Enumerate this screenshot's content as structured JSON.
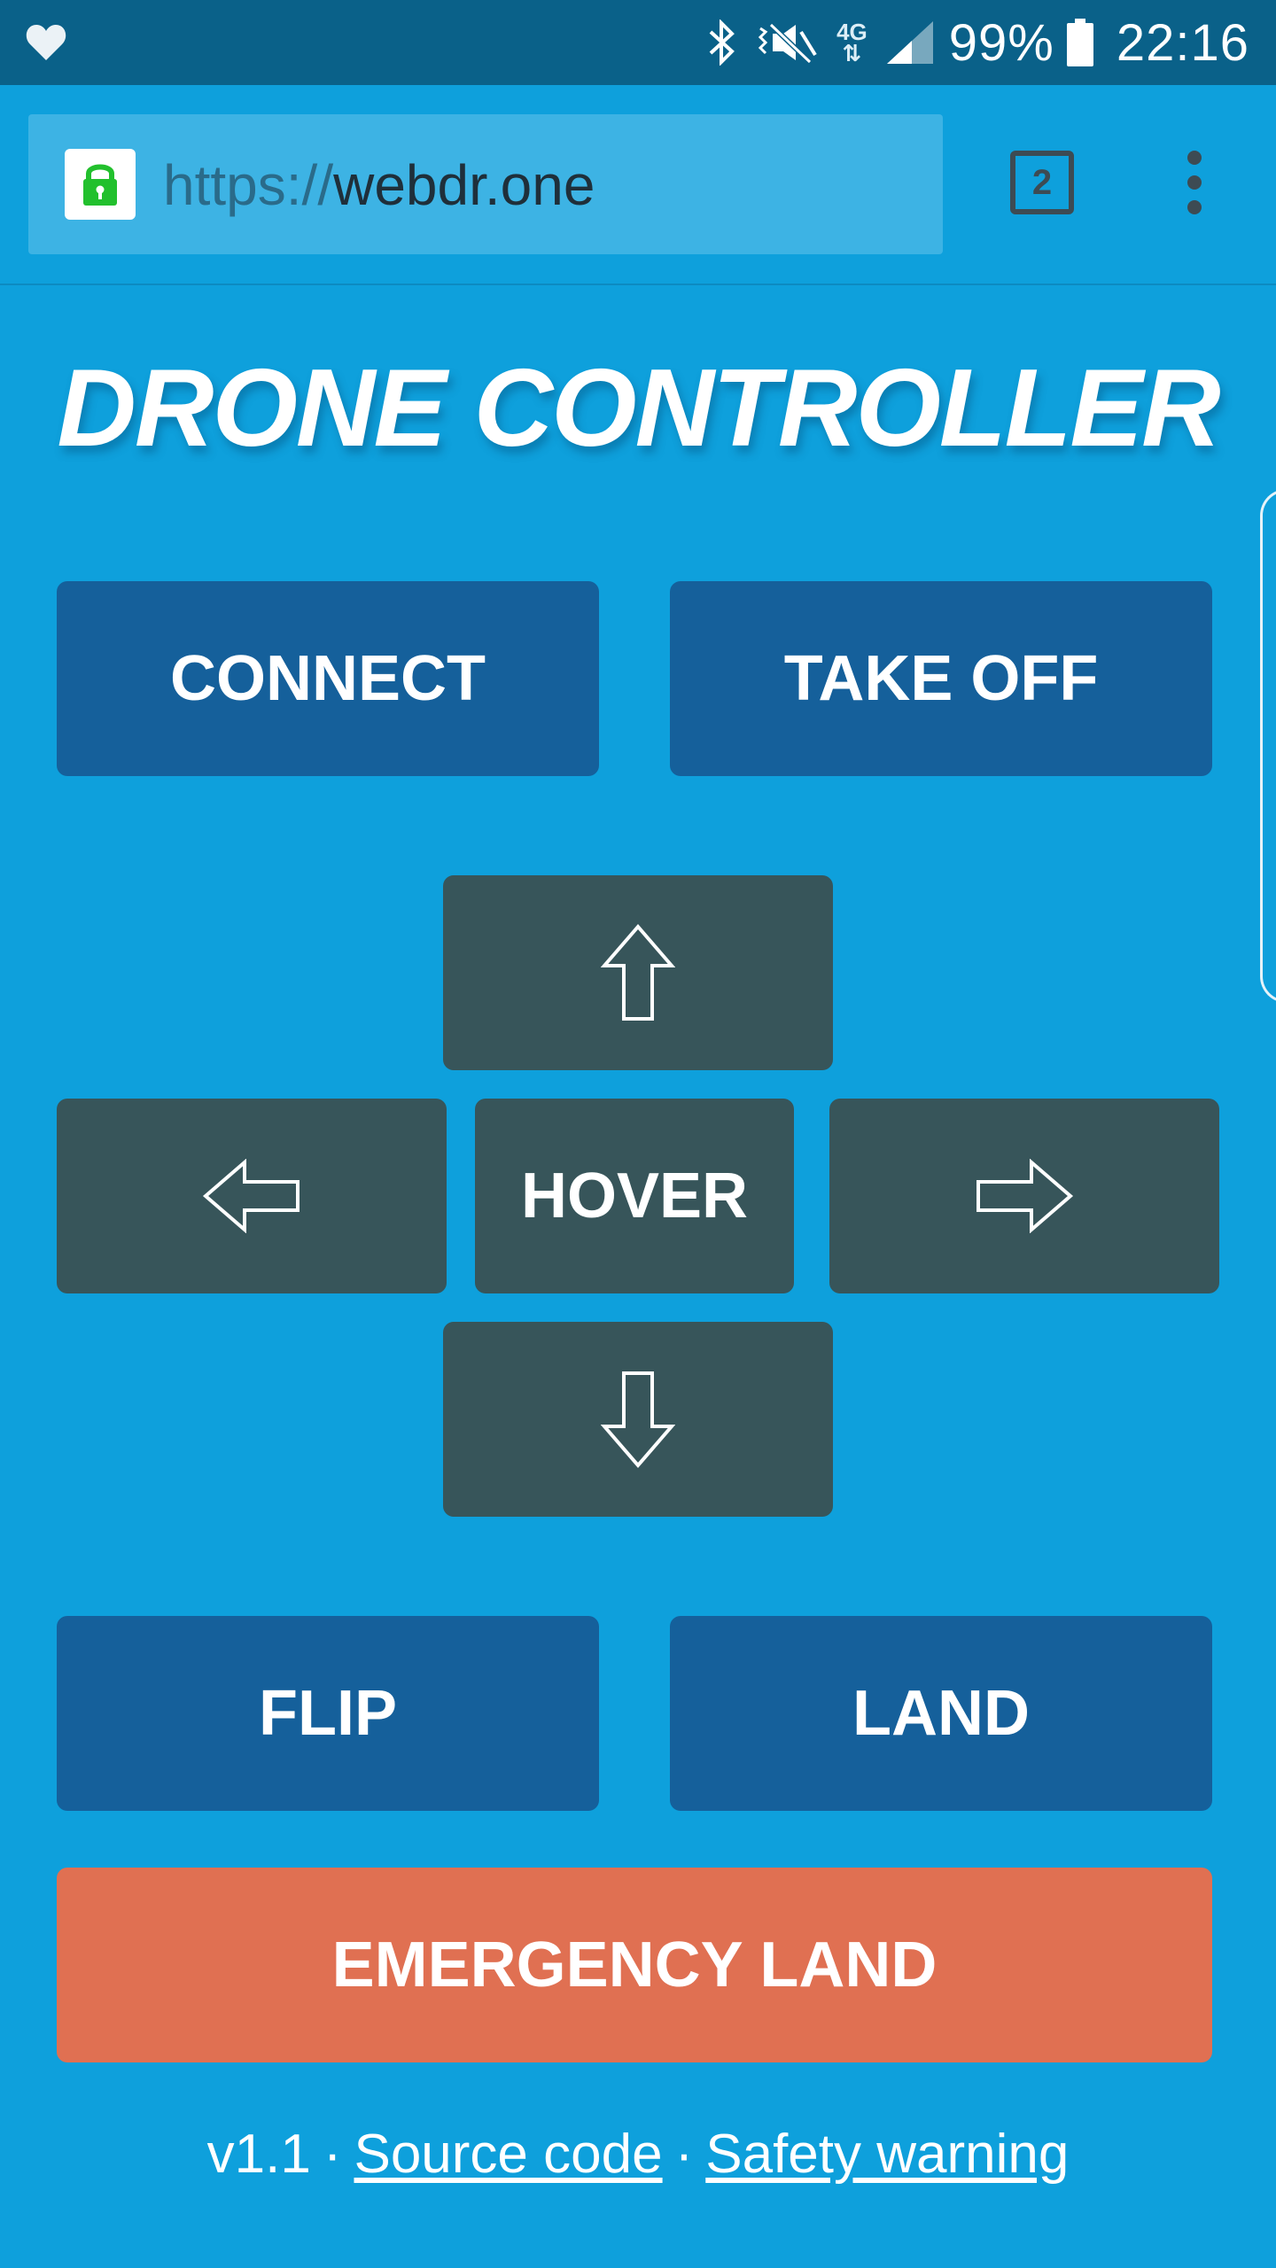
{
  "status_bar": {
    "battery": "99%",
    "time": "22:16",
    "network": "4G",
    "icons": [
      "heart-icon",
      "bluetooth-icon",
      "vibrate-mute-icon",
      "network-4g-icon",
      "signal-icon",
      "battery-icon"
    ]
  },
  "browser": {
    "url_scheme": "https://",
    "url_host": "webdr.one",
    "tab_count": "2",
    "icons": [
      "lock-icon",
      "tabs-icon",
      "overflow-menu-icon"
    ]
  },
  "page": {
    "title": "DRONE CONTROLLER"
  },
  "controls": {
    "connect": "CONNECT",
    "take_off": "TAKE OFF",
    "hover": "HOVER",
    "flip": "FLIP",
    "land": "LAND",
    "emergency_land": "EMERGENCY LAND",
    "direction_icons": [
      "arrow-up-icon",
      "arrow-left-icon",
      "arrow-right-icon",
      "arrow-down-icon"
    ]
  },
  "footer": {
    "version": "v1.1",
    "separator": "·",
    "source_code": "Source code",
    "safety_warning": "Safety warning"
  },
  "colors": {
    "background": "#0ea0dc",
    "status_bar": "#0a6189",
    "primary_button": "#15609b",
    "direction_button": "#37555a",
    "emergency_button": "#e07052",
    "lock_green": "#22c02d"
  }
}
